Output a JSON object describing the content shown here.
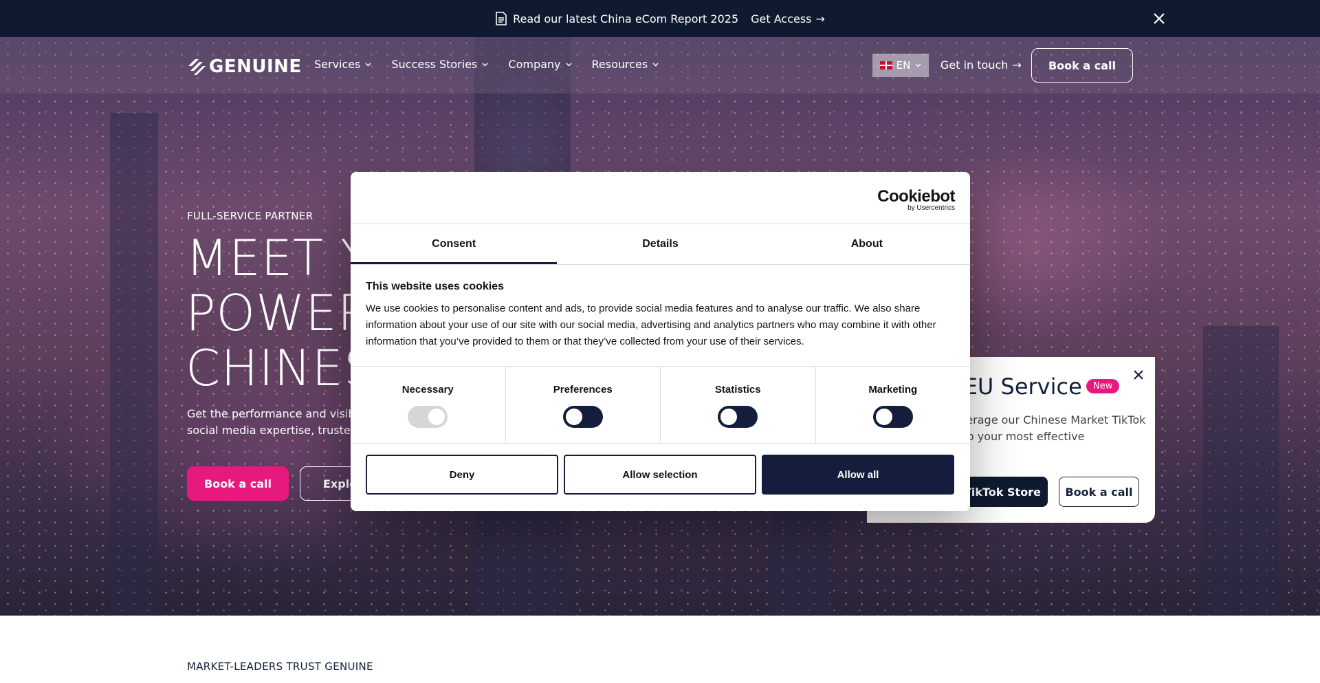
{
  "announcement": {
    "text": "Read our latest China eCom Report 2025",
    "cta": "Get Access",
    "arrow": "→"
  },
  "nav": {
    "logo_text": "GENUINE",
    "items": [
      {
        "label": "Services"
      },
      {
        "label": "Success Stories"
      },
      {
        "label": "Company"
      },
      {
        "label": "Resources"
      }
    ],
    "language": "EN",
    "get_in_touch": "Get in touch",
    "arrow": "→",
    "book_call": "Book a call"
  },
  "hero": {
    "eyebrow": "FULL-SERVICE PARTNER",
    "headline_lines": [
      "MEET Y",
      "POWER",
      "CHINES"
    ],
    "subtext": "Get the performance and visibili social media expertise, trusted b",
    "book_call": "Book a call",
    "explore": "Explo"
  },
  "promo": {
    "title": "k EU Service",
    "badge": "New",
    "text": "everage our Chinese Market TikTok into your most effective",
    "store_button": "TikTok Store",
    "book_button": "Book a call"
  },
  "cookie": {
    "brand": "Cookiebot",
    "brand_sub": "by Usercentrics",
    "tabs": [
      {
        "label": "Consent"
      },
      {
        "label": "Details"
      },
      {
        "label": "About"
      }
    ],
    "heading": "This website uses cookies",
    "body": "We use cookies to personalise content and ads, to provide social media features and to analyse our traffic. We also share information about your use of our site with our social media, advertising and analytics partners who may combine it with other information that you’ve provided to them or that they’ve collected from your use of their services.",
    "categories": [
      {
        "label": "Necessary",
        "state": "on",
        "locked": true
      },
      {
        "label": "Preferences",
        "state": "off",
        "locked": false
      },
      {
        "label": "Statistics",
        "state": "off",
        "locked": false
      },
      {
        "label": "Marketing",
        "state": "off",
        "locked": false
      }
    ],
    "buttons": {
      "deny": "Deny",
      "allow_selection": "Allow selection",
      "allow_all": "Allow all"
    },
    "accent_color": "#141e3c"
  },
  "trust": {
    "heading": "MARKET-LEADERS TRUST GENUINE"
  },
  "colors": {
    "brand_pink": "#e8197e",
    "navy": "#0f1a30"
  }
}
